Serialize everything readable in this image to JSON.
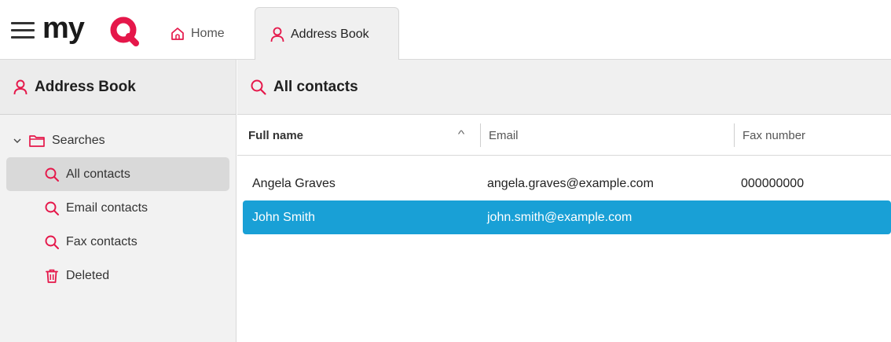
{
  "app": {
    "logo_text": "myQ",
    "colors": {
      "brand": "#e5174a",
      "accent_text": "#1a1a1a",
      "selection": "#19a0d6"
    }
  },
  "tabs": [
    {
      "label": "Home",
      "icon": "home-icon",
      "active": false
    },
    {
      "label": "Address Book",
      "icon": "person-icon",
      "active": true
    }
  ],
  "sidebar": {
    "title": "Address Book",
    "title_icon": "person-icon",
    "tree": {
      "parent": {
        "label": "Searches",
        "icon": "folder-icon",
        "expanded": true
      },
      "items": [
        {
          "label": "All contacts",
          "icon": "search-icon",
          "selected": true
        },
        {
          "label": "Email contacts",
          "icon": "search-icon",
          "selected": false
        },
        {
          "label": "Fax contacts",
          "icon": "search-icon",
          "selected": false
        },
        {
          "label": "Deleted",
          "icon": "trash-icon",
          "selected": false
        }
      ]
    }
  },
  "main": {
    "title": "All contacts",
    "title_icon": "search-icon",
    "columns": [
      {
        "label": "Full name",
        "sorted": "ascending"
      },
      {
        "label": "Email"
      },
      {
        "label": "Fax number"
      }
    ],
    "rows": [
      {
        "name": "Angela Graves",
        "email": "angela.graves@example.com",
        "fax": "000000000",
        "selected": false
      },
      {
        "name": "John Smith",
        "email": "john.smith@example.com",
        "fax": "",
        "selected": true
      }
    ]
  }
}
